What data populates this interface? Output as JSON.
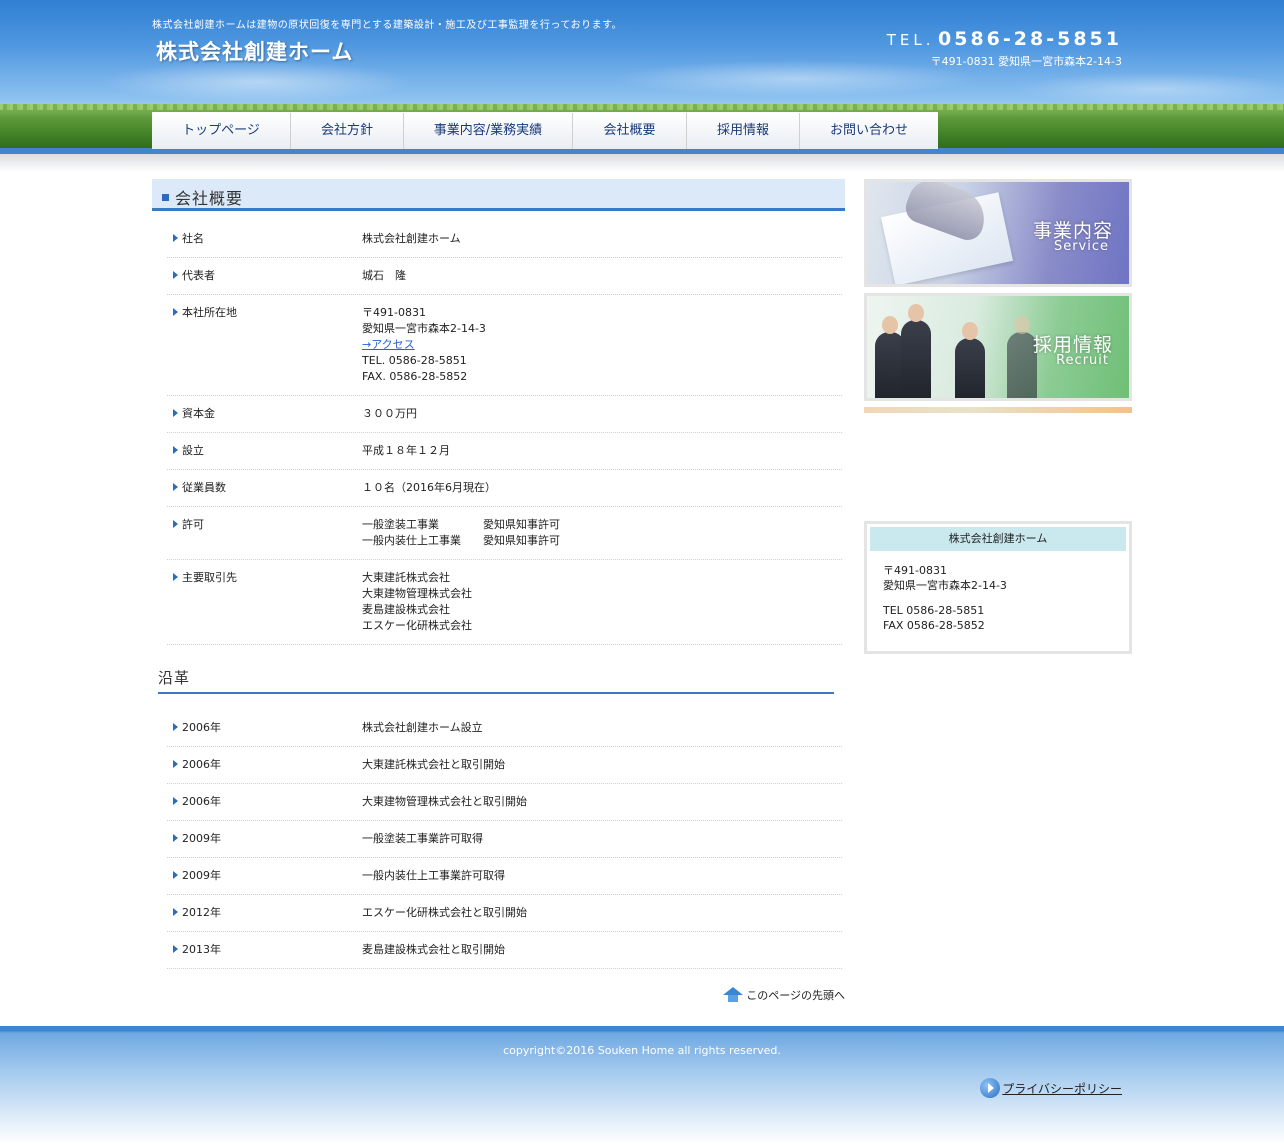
{
  "header": {
    "tagline": "株式会社創建ホームは建物の原状回復を専門とする建築設計・施工及び工事監理を行っております。",
    "logo": "株式会社創建ホーム",
    "tel_label": "TEL.",
    "tel_number": "0586-28-5851",
    "address": "〒491-0831 愛知県一宮市森本2-14-3"
  },
  "nav": [
    {
      "label": "トップページ"
    },
    {
      "label": "会社方針"
    },
    {
      "label": "事業内容/業務実績"
    },
    {
      "label": "会社概要"
    },
    {
      "label": "採用情報"
    },
    {
      "label": "お問い合わせ"
    }
  ],
  "main": {
    "title": "会社概要",
    "rows": [
      {
        "label": "社名",
        "lines": [
          "株式会社創建ホーム"
        ]
      },
      {
        "label": "代表者",
        "lines": [
          "城石　隆"
        ]
      },
      {
        "label": "本社所在地",
        "lines": [
          "〒491-0831",
          "愛知県一宮市森本2-14-3"
        ],
        "link": "→アクセス",
        "lines2": [
          "TEL. 0586-28-5851",
          "FAX. 0586-28-5852"
        ]
      },
      {
        "label": "資本金",
        "lines": [
          "３００万円"
        ]
      },
      {
        "label": "設立",
        "lines": [
          "平成１８年１２月"
        ]
      },
      {
        "label": "従業員数",
        "lines": [
          "１０名（2016年6月現在）"
        ]
      },
      {
        "label": "許可",
        "lines": [
          "一般塗装工事業　　　　愛知県知事許可",
          "一般内装仕上工事業　　愛知県知事許可"
        ]
      },
      {
        "label": "主要取引先",
        "lines": [
          "大東建託株式会社",
          "大東建物管理株式会社",
          "麦島建設株式会社",
          "エスケー化研株式会社"
        ]
      }
    ],
    "history_title": "沿革",
    "history": [
      {
        "year": "2006年",
        "event": "株式会社創建ホーム設立"
      },
      {
        "year": "2006年",
        "event": "大東建託株式会社と取引開始"
      },
      {
        "year": "2006年",
        "event": "大東建物管理株式会社と取引開始"
      },
      {
        "year": "2009年",
        "event": "一般塗装工事業許可取得"
      },
      {
        "year": "2009年",
        "event": "一般内装仕上工事業許可取得"
      },
      {
        "year": "2012年",
        "event": "エスケー化研株式会社と取引開始"
      },
      {
        "year": "2013年",
        "event": "麦島建設株式会社と取引開始"
      }
    ],
    "pagetop": "このページの先頭へ"
  },
  "sidebar": {
    "service_jp": "事業内容",
    "service_en": "Service",
    "recruit_jp": "採用情報",
    "recruit_en": "Recruit",
    "box_title": "株式会社創建ホーム",
    "box_postal": "〒491-0831",
    "box_address": "愛知県一宮市森本2-14-3",
    "box_tel": "TEL 0586-28-5851",
    "box_fax": "FAX 0586-28-5852"
  },
  "footer": {
    "copyright": "copyright©2016 Souken Home all rights reserved.",
    "privacy": "プライバシーポリシー"
  }
}
